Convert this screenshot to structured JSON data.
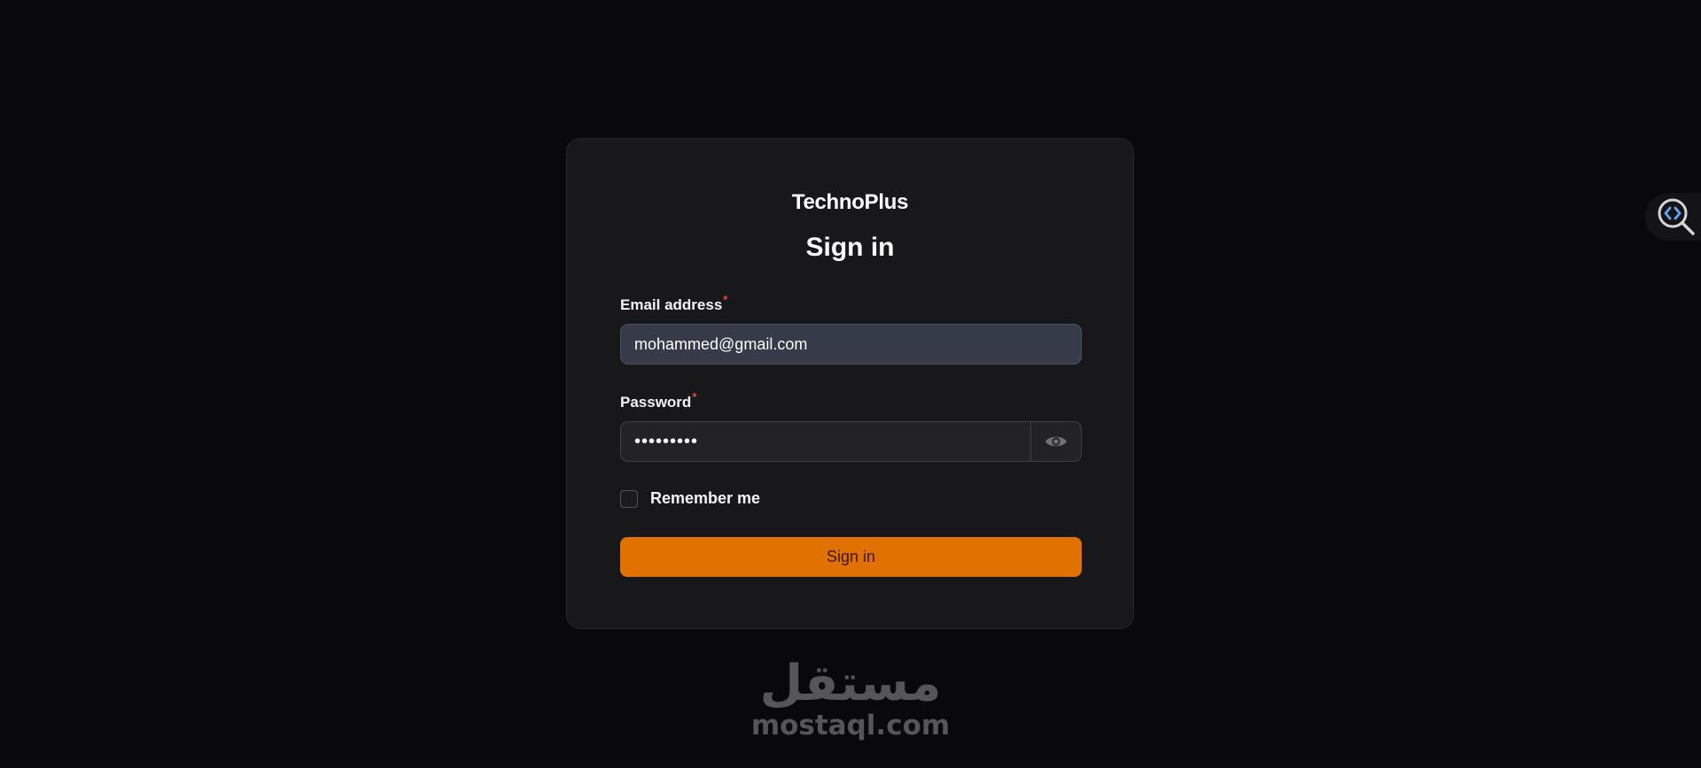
{
  "brand": "TechnoPlus",
  "form": {
    "title": "Sign in",
    "email": {
      "label": "Email address",
      "required_mark": "*",
      "value": "mohammed@gmail.com"
    },
    "password": {
      "label": "Password",
      "required_mark": "*",
      "value": "•••••••••"
    },
    "remember_label": "Remember me",
    "remember_checked": false,
    "submit_label": "Sign in"
  },
  "watermark": {
    "arabic": "مستقل",
    "latin": "mostaql.com"
  },
  "colors": {
    "background": "#09090b",
    "card": "#18181b",
    "accent": "#e17100",
    "required": "#ef4444"
  },
  "icons": {
    "password_toggle": "eye-icon",
    "dev_tool": "code-search-icon"
  }
}
